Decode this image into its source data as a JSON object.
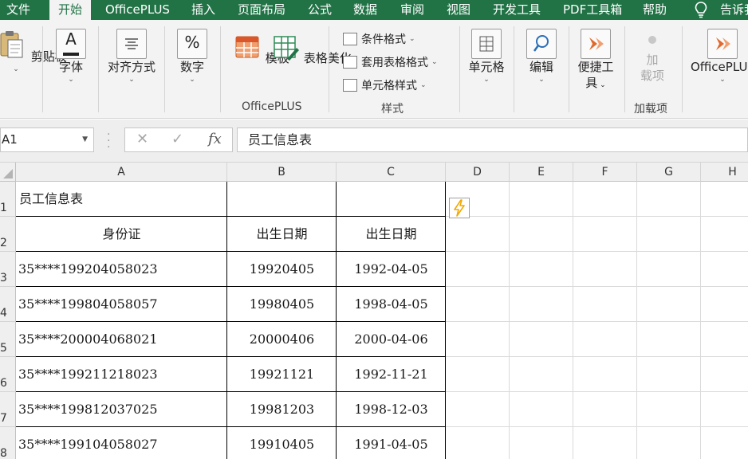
{
  "menu": {
    "tabs": [
      "文件",
      "开始",
      "OfficePLUS",
      "插入",
      "页面布局",
      "公式",
      "数据",
      "审阅",
      "视图",
      "开发工具",
      "PDF工具箱",
      "帮助"
    ],
    "active_tab": "开始",
    "tell_me": "告诉我"
  },
  "ribbon": {
    "clipboard": "剪贴板",
    "font": "字体",
    "alignment": "对齐方式",
    "number": "数字",
    "template": "模板",
    "beautify": "表格美化",
    "officeplus_group": "OfficePLUS",
    "conditional_format": "条件格式",
    "table_format": "套用表格格式",
    "cell_style": "单元格样式",
    "styles_group": "样式",
    "cells": "单元格",
    "edit": "编辑",
    "convenient_tools_1": "便捷工",
    "convenient_tools_2": "具",
    "addins_1": "加",
    "addins_2": "载项",
    "addins_group": "加载项",
    "officeplus_right": "OfficePLUS"
  },
  "formula_bar": {
    "name_box": "A1",
    "cancel": "✕",
    "enter": "✓",
    "fx": "fx",
    "content": "员工信息表"
  },
  "grid": {
    "columns": [
      "A",
      "B",
      "C",
      "D",
      "E",
      "F",
      "G",
      "H"
    ],
    "rows": [
      "1",
      "2",
      "3",
      "4",
      "5",
      "6",
      "7",
      "8"
    ],
    "title": "员工信息表",
    "headers": [
      "身份证",
      "出生日期",
      "出生日期"
    ],
    "data": [
      [
        "35****199204058023",
        "19920405",
        "1992-04-05"
      ],
      [
        "35****199804058057",
        "19980405",
        "1998-04-05"
      ],
      [
        "35****200004068021",
        "20000406",
        "2000-04-06"
      ],
      [
        "35****199211218023",
        "19921121",
        "1992-11-21"
      ],
      [
        "35****199812037025",
        "19981203",
        "1998-12-03"
      ],
      [
        "35****199104058027",
        "19910405",
        "1991-04-05"
      ]
    ]
  },
  "colors": {
    "accent": "#217346",
    "flash_fill": "#f2a900"
  }
}
